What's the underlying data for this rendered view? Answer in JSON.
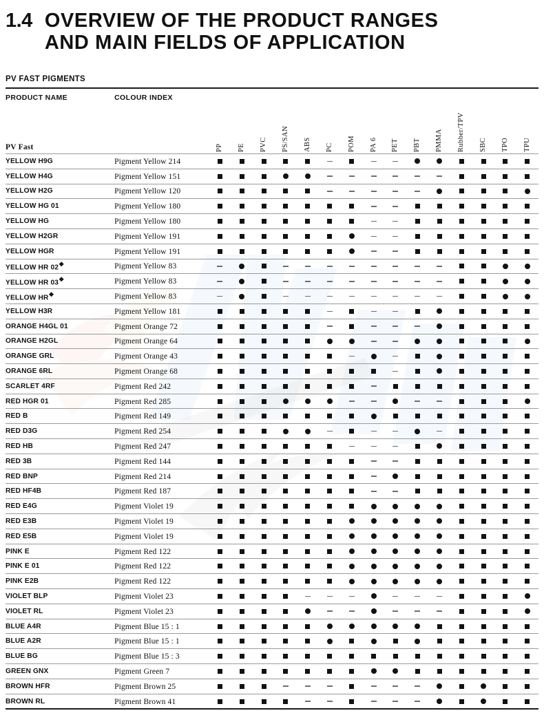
{
  "heading": {
    "number": "1.4",
    "title": "OVERVIEW OF THE PRODUCT RANGES AND MAIN FIELDS OF APPLICATION"
  },
  "section_label": "PV FAST PIGMENTS",
  "table": {
    "col_product_name": "PRODUCT NAME",
    "col_colour_index": "COLOUR INDEX",
    "brand_row_label": "PV Fast",
    "polymer_columns": [
      "PP",
      "PE",
      "PVC",
      "PS/SAN",
      "ABS",
      "PC",
      "POM",
      "PA 6",
      "PET",
      "PBT",
      "PMMA",
      "Rubber/TPV",
      "SBC",
      "TPO",
      "TPU"
    ],
    "symbol_legend": {
      "square": "■",
      "circle": "●",
      "dash": "–"
    },
    "rows": [
      {
        "name": "YELLOW H9G",
        "index": "Pigment Yellow 214",
        "cells": [
          "sq",
          "sq",
          "sq",
          "sq",
          "sq",
          "da",
          "sq",
          "da",
          "da",
          "ci",
          "ci",
          "sq",
          "sq",
          "sq",
          "sq"
        ]
      },
      {
        "name": "YELLOW H4G",
        "index": "Pigment Yellow 151",
        "cells": [
          "sq",
          "sq",
          "sq",
          "ci",
          "ci",
          "da",
          "da",
          "da",
          "da",
          "da",
          "da",
          "sq",
          "sq",
          "sq",
          "sq"
        ]
      },
      {
        "name": "YELLOW H2G",
        "index": "Pigment Yellow 120",
        "cells": [
          "sq",
          "sq",
          "sq",
          "sq",
          "sq",
          "da",
          "da",
          "da",
          "da",
          "da",
          "ci",
          "sq",
          "sq",
          "sq",
          "ci"
        ]
      },
      {
        "name": "YELLOW HG 01",
        "index": "Pigment Yellow 180",
        "cells": [
          "sq",
          "sq",
          "sq",
          "sq",
          "sq",
          "sq",
          "sq",
          "da",
          "da",
          "sq",
          "sq",
          "sq",
          "sq",
          "sq",
          "sq"
        ]
      },
      {
        "name": "YELLOW HG",
        "index": "Pigment Yellow 180",
        "cells": [
          "sq",
          "sq",
          "sq",
          "sq",
          "sq",
          "sq",
          "sq",
          "da",
          "da",
          "sq",
          "sq",
          "sq",
          "sq",
          "sq",
          "sq"
        ]
      },
      {
        "name": "YELLOW H2GR",
        "index": "Pigment Yellow 191",
        "cells": [
          "sq",
          "sq",
          "sq",
          "sq",
          "sq",
          "sq",
          "ci",
          "da",
          "da",
          "sq",
          "sq",
          "sq",
          "sq",
          "sq",
          "sq"
        ]
      },
      {
        "name": "YELLOW HGR",
        "index": "Pigment Yellow 191",
        "cells": [
          "sq",
          "sq",
          "sq",
          "sq",
          "sq",
          "sq",
          "ci",
          "da",
          "da",
          "sq",
          "sq",
          "sq",
          "sq",
          "sq",
          "sq"
        ]
      },
      {
        "name": "YELLOW HR 02*",
        "index": "Pigment Yellow 83",
        "cells": [
          "da",
          "ci",
          "sq",
          "da",
          "da",
          "da",
          "da",
          "da",
          "da",
          "da",
          "da",
          "sq",
          "sq",
          "ci",
          "ci"
        ]
      },
      {
        "name": "YELLOW HR 03*",
        "index": "Pigment Yellow 83",
        "cells": [
          "da",
          "ci",
          "sq",
          "da",
          "da",
          "da",
          "da",
          "da",
          "da",
          "da",
          "da",
          "sq",
          "sq",
          "ci",
          "ci"
        ]
      },
      {
        "name": "YELLOW HR*",
        "index": "Pigment Yellow 83",
        "cells": [
          "da",
          "ci",
          "sq",
          "da",
          "da",
          "da",
          "da",
          "da",
          "da",
          "da",
          "da",
          "sq",
          "sq",
          "ci",
          "ci"
        ]
      },
      {
        "name": "YELLOW H3R",
        "index": "Pigment Yellow 181",
        "cells": [
          "sq",
          "sq",
          "sq",
          "sq",
          "sq",
          "da",
          "sq",
          "da",
          "da",
          "sq",
          "ci",
          "sq",
          "sq",
          "sq",
          "sq"
        ]
      },
      {
        "name": "ORANGE H4GL 01",
        "index": "Pigment Orange 72",
        "cells": [
          "sq",
          "sq",
          "sq",
          "sq",
          "sq",
          "da",
          "sq",
          "da",
          "da",
          "da",
          "ci",
          "sq",
          "sq",
          "sq",
          "sq"
        ]
      },
      {
        "name": "ORANGE H2GL",
        "index": "Pigment Orange 64",
        "cells": [
          "sq",
          "sq",
          "sq",
          "sq",
          "sq",
          "ci",
          "ci",
          "da",
          "da",
          "ci",
          "ci",
          "sq",
          "sq",
          "sq",
          "ci"
        ]
      },
      {
        "name": "ORANGE GRL",
        "index": "Pigment Orange 43",
        "cells": [
          "sq",
          "sq",
          "sq",
          "sq",
          "sq",
          "sq",
          "da",
          "ci",
          "da",
          "sq",
          "ci",
          "sq",
          "sq",
          "sq",
          "sq"
        ]
      },
      {
        "name": "ORANGE 6RL",
        "index": "Pigment Orange 68",
        "cells": [
          "sq",
          "sq",
          "sq",
          "sq",
          "sq",
          "sq",
          "sq",
          "sq",
          "da",
          "sq",
          "ci",
          "sq",
          "sq",
          "sq",
          "sq"
        ]
      },
      {
        "name": "SCARLET 4RF",
        "index": "Pigment Red 242",
        "cells": [
          "sq",
          "sq",
          "sq",
          "sq",
          "sq",
          "sq",
          "sq",
          "da",
          "sq",
          "sq",
          "sq",
          "sq",
          "sq",
          "sq",
          "sq"
        ]
      },
      {
        "name": "RED HGR 01",
        "index": "Pigment Red 285",
        "cells": [
          "sq",
          "sq",
          "sq",
          "ci",
          "ci",
          "ci",
          "da",
          "da",
          "ci",
          "da",
          "da",
          "sq",
          "sq",
          "sq",
          "ci"
        ]
      },
      {
        "name": "RED B",
        "index": "Pigment Red 149",
        "cells": [
          "sq",
          "sq",
          "sq",
          "sq",
          "sq",
          "sq",
          "sq",
          "ci",
          "sq",
          "sq",
          "sq",
          "sq",
          "sq",
          "sq",
          "sq"
        ]
      },
      {
        "name": "RED D3G",
        "index": "Pigment Red 254",
        "cells": [
          "sq",
          "sq",
          "sq",
          "ci",
          "ci",
          "da",
          "sq",
          "da",
          "da",
          "ci",
          "da",
          "sq",
          "sq",
          "sq",
          "sq"
        ]
      },
      {
        "name": "RED HB",
        "index": "Pigment Red 247",
        "cells": [
          "sq",
          "sq",
          "sq",
          "sq",
          "sq",
          "sq",
          "da",
          "da",
          "da",
          "sq",
          "ci",
          "sq",
          "sq",
          "sq",
          "sq"
        ]
      },
      {
        "name": "RED 3B",
        "index": "Pigment Red 144",
        "cells": [
          "sq",
          "sq",
          "sq",
          "sq",
          "sq",
          "sq",
          "sq",
          "da",
          "da",
          "sq",
          "sq",
          "sq",
          "sq",
          "sq",
          "sq"
        ]
      },
      {
        "name": "RED BNP",
        "index": "Pigment Red 214",
        "cells": [
          "sq",
          "sq",
          "sq",
          "sq",
          "sq",
          "sq",
          "sq",
          "da",
          "ci",
          "sq",
          "sq",
          "sq",
          "sq",
          "sq",
          "sq"
        ]
      },
      {
        "name": "RED HF4B",
        "index": "Pigment Red 187",
        "cells": [
          "sq",
          "sq",
          "sq",
          "sq",
          "sq",
          "sq",
          "sq",
          "da",
          "da",
          "sq",
          "sq",
          "sq",
          "sq",
          "sq",
          "sq"
        ]
      },
      {
        "name": "RED E4G",
        "index": "Pigment Violet 19",
        "cells": [
          "sq",
          "sq",
          "sq",
          "sq",
          "sq",
          "sq",
          "sq",
          "ci",
          "ci",
          "ci",
          "ci",
          "sq",
          "sq",
          "sq",
          "sq"
        ]
      },
      {
        "name": "RED E3B",
        "index": "Pigment Violet 19",
        "cells": [
          "sq",
          "sq",
          "sq",
          "sq",
          "sq",
          "sq",
          "ci",
          "ci",
          "ci",
          "ci",
          "ci",
          "sq",
          "sq",
          "sq",
          "sq"
        ]
      },
      {
        "name": "RED E5B",
        "index": "Pigment Violet 19",
        "cells": [
          "sq",
          "sq",
          "sq",
          "sq",
          "sq",
          "sq",
          "ci",
          "ci",
          "ci",
          "ci",
          "ci",
          "sq",
          "sq",
          "sq",
          "sq"
        ]
      },
      {
        "name": "PINK E",
        "index": "Pigment Red 122",
        "cells": [
          "sq",
          "sq",
          "sq",
          "sq",
          "sq",
          "sq",
          "ci",
          "ci",
          "ci",
          "ci",
          "ci",
          "sq",
          "sq",
          "sq",
          "sq"
        ]
      },
      {
        "name": "PINK E 01",
        "index": "Pigment Red 122",
        "cells": [
          "sq",
          "sq",
          "sq",
          "sq",
          "sq",
          "sq",
          "ci",
          "ci",
          "ci",
          "ci",
          "ci",
          "sq",
          "sq",
          "sq",
          "sq"
        ]
      },
      {
        "name": "PINK E2B",
        "index": "Pigment Red 122",
        "cells": [
          "sq",
          "sq",
          "sq",
          "sq",
          "sq",
          "sq",
          "ci",
          "ci",
          "ci",
          "ci",
          "ci",
          "sq",
          "sq",
          "sq",
          "sq"
        ]
      },
      {
        "name": "VIOLET BLP",
        "index": "Pigment Violet 23",
        "cells": [
          "sq",
          "sq",
          "sq",
          "sq",
          "da",
          "da",
          "da",
          "ci",
          "da",
          "da",
          "da",
          "sq",
          "sq",
          "sq",
          "ci"
        ]
      },
      {
        "name": "VIOLET RL",
        "index": "Pigment Violet 23",
        "cells": [
          "sq",
          "sq",
          "sq",
          "sq",
          "ci",
          "da",
          "da",
          "ci",
          "da",
          "da",
          "da",
          "sq",
          "sq",
          "sq",
          "ci"
        ]
      },
      {
        "name": "BLUE A4R",
        "index": "Pigment Blue 15 : 1",
        "cells": [
          "sq",
          "sq",
          "sq",
          "sq",
          "sq",
          "ci",
          "ci",
          "ci",
          "ci",
          "ci",
          "sq",
          "sq",
          "sq",
          "sq",
          "sq"
        ]
      },
      {
        "name": "BLUE A2R",
        "index": "Pigment Blue 15 : 1",
        "cells": [
          "sq",
          "sq",
          "sq",
          "sq",
          "sq",
          "ci",
          "sq",
          "ci",
          "sq",
          "ci",
          "sq",
          "sq",
          "sq",
          "sq",
          "sq"
        ]
      },
      {
        "name": "BLUE BG",
        "index": "Pigment Blue 15 : 3",
        "cells": [
          "sq",
          "sq",
          "sq",
          "sq",
          "sq",
          "sq",
          "sq",
          "sq",
          "sq",
          "sq",
          "sq",
          "sq",
          "sq",
          "sq",
          "sq"
        ]
      },
      {
        "name": "GREEN GNX",
        "index": "Pigment Green 7",
        "cells": [
          "sq",
          "sq",
          "sq",
          "sq",
          "sq",
          "sq",
          "sq",
          "ci",
          "ci",
          "sq",
          "sq",
          "sq",
          "sq",
          "sq",
          "sq"
        ]
      },
      {
        "name": "BROWN HFR",
        "index": "Pigment Brown 25",
        "cells": [
          "sq",
          "sq",
          "sq",
          "da",
          "da",
          "da",
          "sq",
          "da",
          "da",
          "da",
          "ci",
          "sq",
          "ci",
          "sq",
          "sq"
        ]
      },
      {
        "name": "BROWN RL",
        "index": "Pigment Brown 41",
        "cells": [
          "sq",
          "sq",
          "sq",
          "sq",
          "da",
          "da",
          "sq",
          "da",
          "da",
          "da",
          "ci",
          "sq",
          "ci",
          "sq",
          "sq"
        ]
      }
    ]
  }
}
